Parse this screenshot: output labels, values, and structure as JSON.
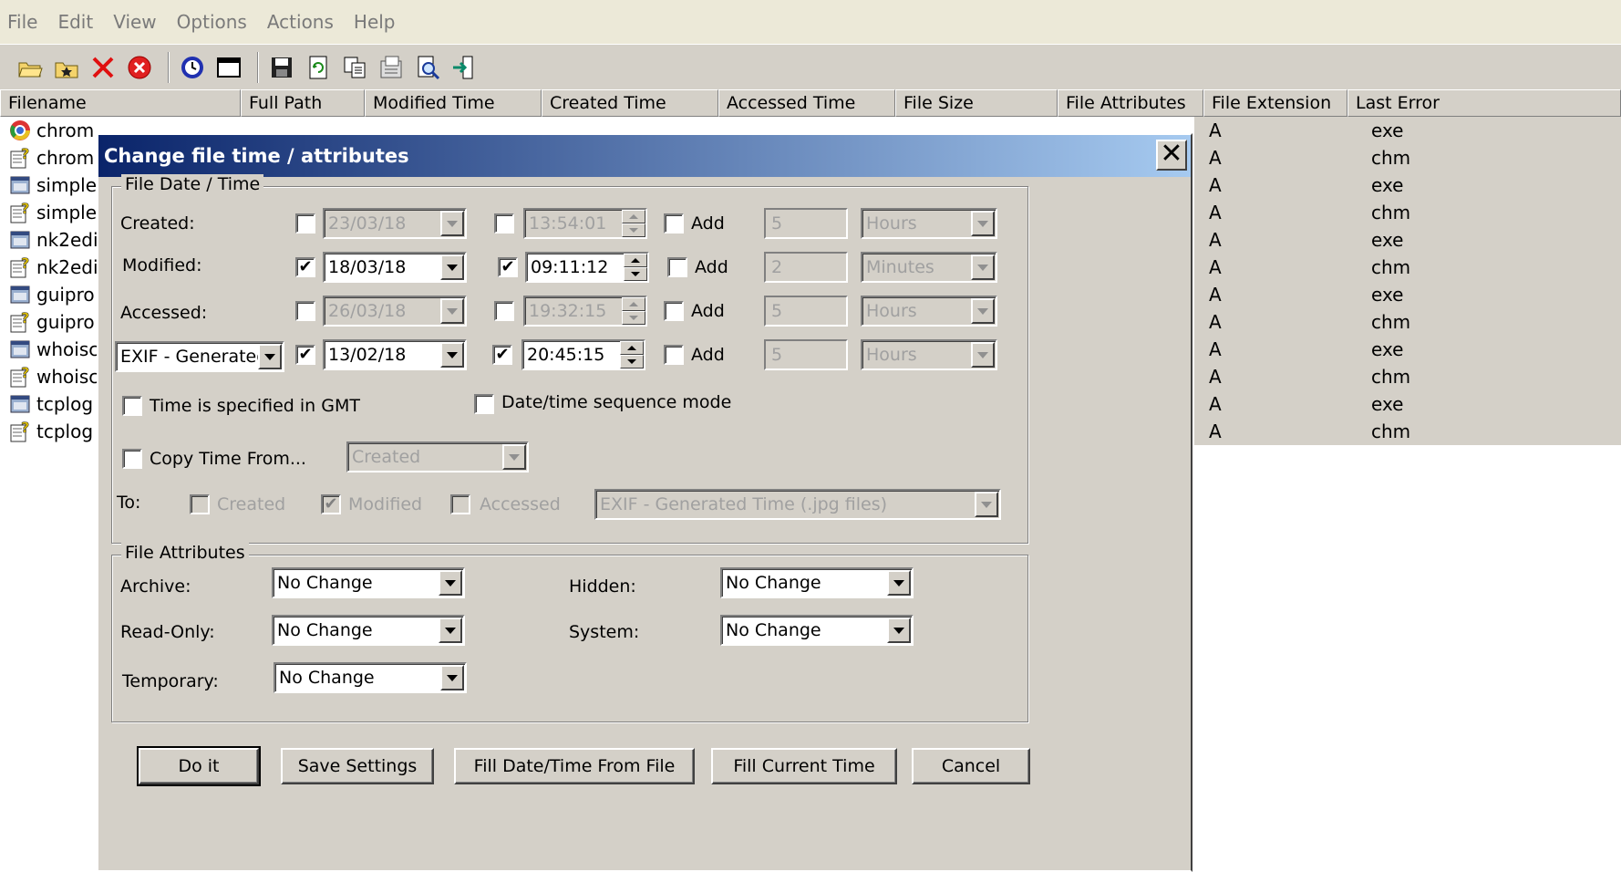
{
  "menu": [
    "File",
    "Edit",
    "View",
    "Options",
    "Actions",
    "Help"
  ],
  "toolbar_icons": [
    "open-folder-icon",
    "add-folder-icon",
    "delete-icon",
    "stop-icon",
    "clock-icon",
    "window-icon",
    "save-icon",
    "refresh-icon",
    "copy-icon",
    "properties-icon",
    "find-icon",
    "exit-icon"
  ],
  "columns": [
    "Filename",
    "Full Path",
    "Modified Time",
    "Created Time",
    "Accessed Time",
    "File Size",
    "File Attributes",
    "File Extension",
    "Last Error"
  ],
  "files": [
    {
      "name": "chrom",
      "attr": "A",
      "ext": "exe",
      "icon": "chrome-icon"
    },
    {
      "name": "chrom",
      "attr": "A",
      "ext": "chm",
      "icon": "help-file-icon"
    },
    {
      "name": "simple",
      "attr": "A",
      "ext": "exe",
      "icon": "app-icon"
    },
    {
      "name": "simple",
      "attr": "A",
      "ext": "chm",
      "icon": "help-file-icon"
    },
    {
      "name": "nk2edi",
      "attr": "A",
      "ext": "exe",
      "icon": "app-icon"
    },
    {
      "name": "nk2edi",
      "attr": "A",
      "ext": "chm",
      "icon": "help-file-icon"
    },
    {
      "name": "guipro",
      "attr": "A",
      "ext": "exe",
      "icon": "app-icon"
    },
    {
      "name": "guipro",
      "attr": "A",
      "ext": "chm",
      "icon": "help-file-icon"
    },
    {
      "name": "whoisc",
      "attr": "A",
      "ext": "exe",
      "icon": "app-icon"
    },
    {
      "name": "whoisc",
      "attr": "A",
      "ext": "chm",
      "icon": "help-file-icon"
    },
    {
      "name": "tcplog",
      "attr": "A",
      "ext": "exe",
      "icon": "app-icon"
    },
    {
      "name": "tcplog",
      "attr": "A",
      "ext": "chm",
      "icon": "help-file-icon"
    }
  ],
  "dialog": {
    "title": "Change file time / attributes",
    "close": "✕",
    "date_group": "File Date / Time",
    "rows": {
      "created": {
        "label": "Created:",
        "date": "23/03/18",
        "time": "13:54:01",
        "add": "Add",
        "amount": "5",
        "unit": "Hours",
        "date_checked": false,
        "time_checked": false
      },
      "modified": {
        "label": "Modified:",
        "date": "18/03/18",
        "time": "09:11:12",
        "add": "Add",
        "amount": "2",
        "unit": "Minutes",
        "date_checked": true,
        "time_checked": true
      },
      "accessed": {
        "label": "Accessed:",
        "date": "26/03/18",
        "time": "19:32:15",
        "add": "Add",
        "amount": "5",
        "unit": "Hours",
        "date_checked": false,
        "time_checked": false
      },
      "exif": {
        "label": "EXIF - Generated",
        "date": "13/02/18",
        "time": "20:45:15",
        "add": "Add",
        "amount": "5",
        "unit": "Hours",
        "date_checked": true,
        "time_checked": true
      }
    },
    "gmt": "Time is specified in GMT",
    "sequence": "Date/time sequence mode",
    "copy_from": "Copy Time From...",
    "copy_source": "Created",
    "to": "To:",
    "to_created": "Created",
    "to_modified": "Modified",
    "to_accessed": "Accessed",
    "to_exif": "EXIF - Generated Time (.jpg files)",
    "attr_group": "File Attributes",
    "archive": {
      "label": "Archive:",
      "value": "No Change"
    },
    "hidden": {
      "label": "Hidden:",
      "value": "No Change"
    },
    "readonly": {
      "label": "Read-Only:",
      "value": "No Change"
    },
    "system": {
      "label": "System:",
      "value": "No Change"
    },
    "temporary": {
      "label": "Temporary:",
      "value": "No Change"
    },
    "buttons": {
      "do_it": "Do it",
      "save": "Save Settings",
      "fill_file": "Fill Date/Time From File",
      "fill_current": "Fill Current Time",
      "cancel": "Cancel"
    }
  }
}
